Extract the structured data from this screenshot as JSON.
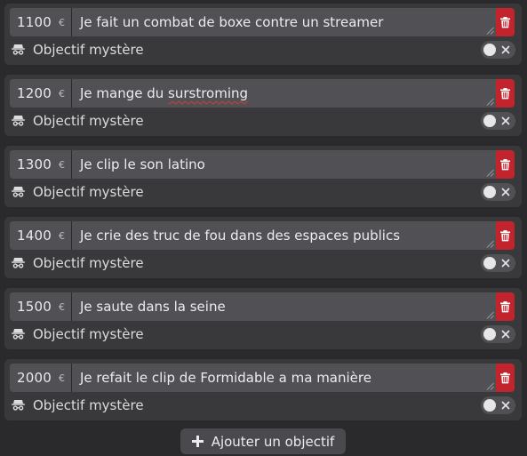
{
  "goals": [
    {
      "amount": "1100",
      "currency": "€",
      "text": "Je fait un combat de boxe contre un streamer",
      "mystery_label": "Objectif mystère",
      "mystery_enabled": false
    },
    {
      "amount": "1200",
      "currency": "€",
      "text_before": "Je mange du ",
      "text_misspelled": "surstroming",
      "mystery_label": "Objectif mystère",
      "mystery_enabled": false
    },
    {
      "amount": "1300",
      "currency": "€",
      "text": "Je clip le son latino",
      "mystery_label": "Objectif mystère",
      "mystery_enabled": false
    },
    {
      "amount": "1400",
      "currency": "€",
      "text": "Je crie des truc de fou dans des espaces publics",
      "mystery_label": "Objectif mystère",
      "mystery_enabled": false
    },
    {
      "amount": "1500",
      "currency": "€",
      "text": "Je saute dans la seine",
      "mystery_label": "Objectif mystère",
      "mystery_enabled": false
    },
    {
      "amount": "2000",
      "currency": "€",
      "text": "Je refait le clip de Formidable a ma manière",
      "mystery_label": "Objectif mystère",
      "mystery_enabled": false
    }
  ],
  "add_button": {
    "label": "Ajouter un objectif",
    "icon": "plus-icon"
  },
  "icons": {
    "delete": "trash-icon",
    "mystery": "spy-icon",
    "toggle_off": "close-icon"
  },
  "colors": {
    "background": "#2a2a2c",
    "card": "#39393c",
    "field": "#515155",
    "delete": "#c3242b",
    "text": "#ececee",
    "spellcheck": "#d33a3a"
  }
}
